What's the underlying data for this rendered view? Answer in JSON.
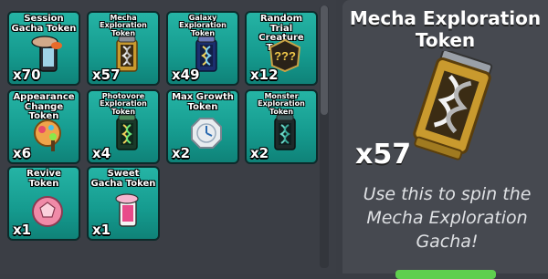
{
  "inventory": {
    "tiles": [
      {
        "name": "Session Gacha Token",
        "count": "x70",
        "icon": "session-gacha-token-icon"
      },
      {
        "name": "Mecha Exploration Token",
        "count": "x57",
        "icon": "mecha-exploration-token-icon",
        "selected": true
      },
      {
        "name": "Galaxy Exploration Token",
        "count": "x49",
        "icon": "galaxy-exploration-token-icon"
      },
      {
        "name": "Random Trial Creature Token",
        "count": "x12",
        "icon": "random-trial-creature-token-icon"
      },
      {
        "name": "Appearance Change Token",
        "count": "x6",
        "icon": "appearance-change-token-icon"
      },
      {
        "name": "Photovore Exploration Token",
        "count": "x4",
        "icon": "photovore-exploration-token-icon"
      },
      {
        "name": "Max Growth Token",
        "count": "x2",
        "icon": "max-growth-token-icon"
      },
      {
        "name": "Monster Exploration Token",
        "count": "x2",
        "icon": "monster-exploration-token-icon"
      },
      {
        "name": "Revive Token",
        "count": "x1",
        "icon": "revive-token-icon"
      },
      {
        "name": "Sweet Gacha Token",
        "count": "x1",
        "icon": "sweet-gacha-token-icon"
      }
    ]
  },
  "detail": {
    "title": "Mecha Exploration Token",
    "count": "x57",
    "description": "Use this to spin the Mecha Exploration Gacha!",
    "icon": "mecha-exploration-token-icon"
  }
}
